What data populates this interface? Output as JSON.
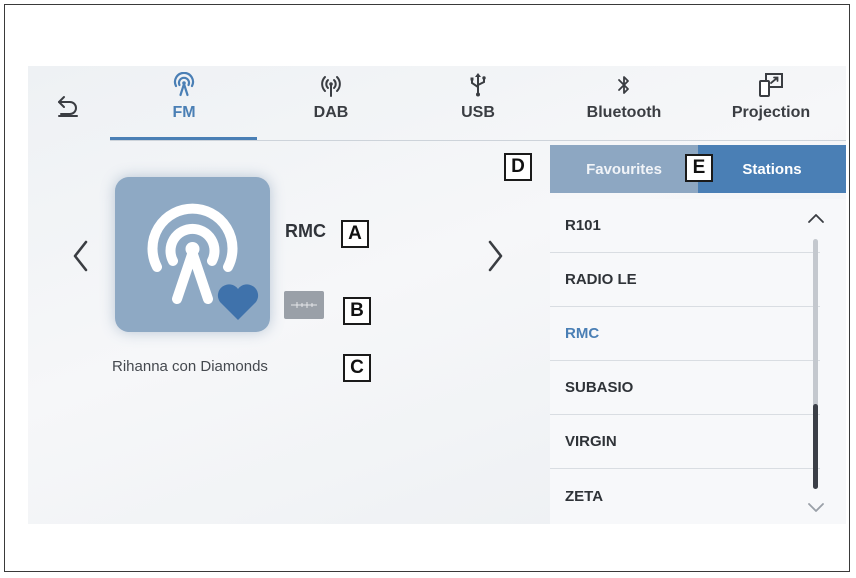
{
  "nav": {
    "back_icon": "back-arrow-icon",
    "tabs": [
      {
        "label": "FM",
        "icon": "radio-broadcast-icon",
        "active": true
      },
      {
        "label": "DAB",
        "icon": "antenna-icon",
        "active": false
      },
      {
        "label": "USB",
        "icon": "usb-icon",
        "active": false
      },
      {
        "label": "Bluetooth",
        "icon": "bluetooth-icon",
        "active": false
      },
      {
        "label": "Projection",
        "icon": "projection-icon",
        "active": false
      }
    ],
    "accent_color": "#4a7fb5"
  },
  "now_playing": {
    "station": "RMC",
    "song": "Rihanna con Diamonds",
    "artwork_icon": "radio-broadcast-icon",
    "favourite_icon": "heart-icon",
    "hd_icon": "signal-badge-icon",
    "prev_icon": "chevron-left-icon",
    "next_icon": "chevron-right-icon"
  },
  "panel": {
    "tabs": [
      {
        "label": "Favourites",
        "active": false
      },
      {
        "label": "Stations",
        "active": true
      }
    ],
    "stations": [
      {
        "name": "R101",
        "selected": false
      },
      {
        "name": "RADIO LE",
        "selected": false
      },
      {
        "name": "RMC",
        "selected": true
      },
      {
        "name": "SUBASIO",
        "selected": false
      },
      {
        "name": "VIRGIN",
        "selected": false
      },
      {
        "name": "ZETA",
        "selected": false
      }
    ],
    "scroll_position": 0.8
  },
  "callouts": {
    "a": "A",
    "b": "B",
    "c": "C",
    "d": "D",
    "e": "E"
  }
}
